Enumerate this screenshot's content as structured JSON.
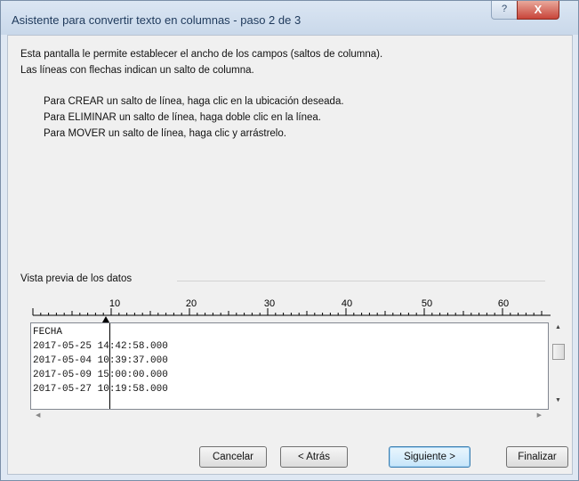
{
  "window": {
    "title": "Asistente para convertir texto en columnas - paso 2 de 3",
    "help_label": "?",
    "close_label": "X"
  },
  "description": {
    "line1": "Esta pantalla le permite establecer el ancho de los campos (saltos de columna).",
    "line2": "Las líneas con flechas indican un salto de columna."
  },
  "instructions": [
    "Para CREAR un salto de línea, haga clic en la ubicación deseada.",
    "Para ELIMINAR un salto de línea, haga doble clic en la línea.",
    "Para MOVER un salto de línea, haga clic y arrástrelo."
  ],
  "preview": {
    "label": "Vista previa de los datos",
    "ruler_ticks": [
      "10",
      "20",
      "30",
      "40",
      "50",
      "60"
    ],
    "column_break_at": 10,
    "lines": [
      "FECHA",
      "2017-05-25 14:42:58.000",
      "2017-05-04 10:39:37.000",
      "2017-05-09 15:00:00.000",
      "2017-05-27 10:19:58.000"
    ]
  },
  "buttons": {
    "cancel": "Cancelar",
    "back": "< Atrás",
    "next": "Siguiente >",
    "finish": "Finalizar"
  },
  "colors": {
    "title_text": "#1e395b",
    "close_button": "#c8453a",
    "default_button_border": "#3c7fb1"
  }
}
